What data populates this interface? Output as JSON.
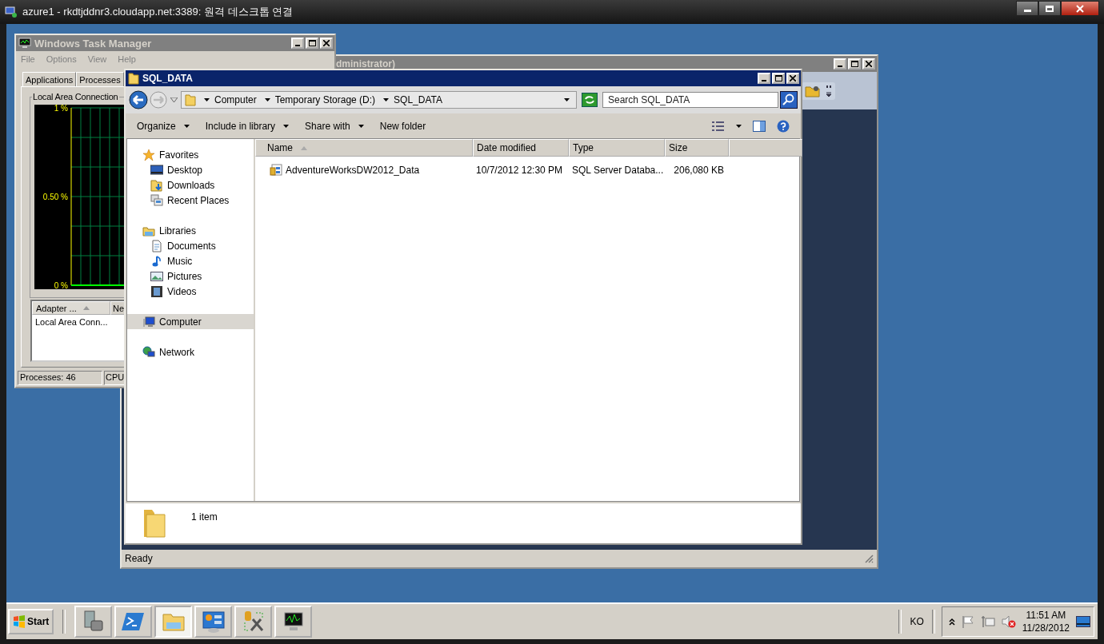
{
  "remote_window": {
    "title": "azure1 - rkdtjddnr3.cloudapp.net:3389: 원격 데스크톱 연결"
  },
  "task_manager": {
    "title": "Windows Task Manager",
    "menu": [
      "File",
      "Options",
      "View",
      "Help"
    ],
    "tabs": [
      {
        "label": "Applications",
        "selected": false
      },
      {
        "label": "Processes",
        "selected": false
      }
    ],
    "group_label": "Local Area Connection",
    "chart_data": {
      "type": "line",
      "ylim": [
        0,
        1
      ],
      "yticks": [
        {
          "value": 0,
          "label": "0 %"
        },
        {
          "value": 0.5,
          "label": "0.50 %"
        },
        {
          "value": 1,
          "label": "1 %"
        }
      ],
      "series": [
        {
          "color": "#00ff00",
          "values": [
            0,
            0,
            0,
            0,
            0,
            0,
            0,
            0
          ]
        }
      ]
    },
    "list": {
      "columns": [
        {
          "label": "Adapter ...",
          "sorted": true
        },
        {
          "label": "Ne",
          "sorted": false
        }
      ],
      "rows": [
        [
          "Local Area Conn..."
        ]
      ]
    },
    "status_bar": [
      "Processes: 46",
      "CPU"
    ]
  },
  "background_window": {
    "title": "dministrator)",
    "status": "Ready"
  },
  "explorer": {
    "title": "SQL_DATA",
    "breadcrumb": [
      "Computer",
      "Temporary Storage (D:)",
      "SQL_DATA"
    ],
    "search": {
      "placeholder": "Search SQL_DATA"
    },
    "commands": [
      {
        "label": "Organize",
        "dropdown": true
      },
      {
        "label": "Include in library",
        "dropdown": true
      },
      {
        "label": "Share with",
        "dropdown": true
      },
      {
        "label": "New folder",
        "dropdown": false
      }
    ],
    "nav": [
      {
        "label": "Favorites",
        "kind": "star",
        "selected": false,
        "children": [
          {
            "label": "Desktop",
            "kind": "desktop",
            "selected": false
          },
          {
            "label": "Downloads",
            "kind": "downloads",
            "selected": false
          },
          {
            "label": "Recent Places",
            "kind": "recent",
            "selected": false
          }
        ]
      },
      {
        "label": "Libraries",
        "kind": "library",
        "selected": false,
        "children": [
          {
            "label": "Documents",
            "kind": "document",
            "selected": false
          },
          {
            "label": "Music",
            "kind": "music",
            "selected": false
          },
          {
            "label": "Pictures",
            "kind": "pictures",
            "selected": false
          },
          {
            "label": "Videos",
            "kind": "videos",
            "selected": false
          }
        ]
      },
      {
        "label": "Computer",
        "kind": "computer",
        "selected": true
      },
      {
        "label": "Network",
        "kind": "network",
        "selected": false
      }
    ],
    "columns": [
      {
        "label": "Name",
        "sorted": true
      },
      {
        "label": "Date modified",
        "sorted": false
      },
      {
        "label": "Type",
        "sorted": false
      },
      {
        "label": "Size",
        "sorted": false
      }
    ],
    "rows": [
      {
        "name": "AdventureWorksDW2012_Data",
        "date": "10/7/2012 12:30 PM",
        "type": "SQL Server Databa...",
        "size": "206,080 KB"
      }
    ],
    "details": "1 item"
  },
  "taskbar": {
    "start": "Start",
    "buttons": [
      {
        "kind": "server",
        "selected": false
      },
      {
        "kind": "powershell",
        "selected": false
      },
      {
        "kind": "explorer",
        "selected": true
      },
      {
        "kind": "control",
        "selected": false
      },
      {
        "kind": "tools",
        "selected": false
      },
      {
        "kind": "monitor",
        "selected": false
      }
    ],
    "language": "KO",
    "time": "11:51 AM",
    "date": "11/28/2012"
  }
}
